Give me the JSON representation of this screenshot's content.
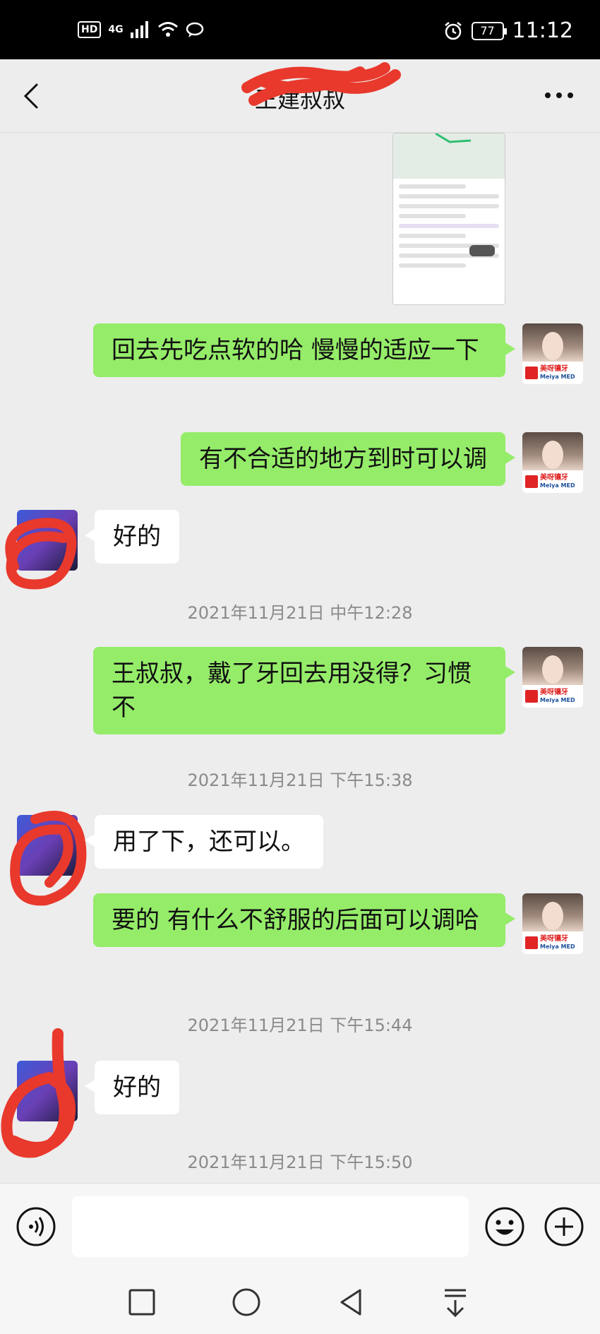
{
  "status_bar": {
    "hd": "HD",
    "network": "4G",
    "battery": "77",
    "time": "11:12"
  },
  "header": {
    "title": "王建叔叔"
  },
  "messages": [
    {
      "text": "回去先吃点软的哈 慢慢的适应一下"
    },
    {
      "text": "有不合适的地方到时可以调"
    },
    {
      "text": "好的"
    },
    {
      "text": "王叔叔，戴了牙回去用没得？习惯不"
    },
    {
      "text": "用了下，还可以。"
    },
    {
      "text": "要的 有什么不舒服的后面可以调哈"
    },
    {
      "text": "好的"
    }
  ],
  "timestamps": [
    "2021年11月21日 中午12:28",
    "2021年11月21日 下午15:38",
    "2021年11月21日 下午15:44",
    "2021年11月21日 下午15:50"
  ],
  "my_avatar": {
    "brand_cn": "美呀镶牙",
    "brand_en": "Meiya MED"
  },
  "colors": {
    "my_bubble": "#95ec69",
    "their_bubble": "#ffffff",
    "background": "#ededed",
    "redaction": "#e8392c"
  },
  "icons": [
    "back-arrow-icon",
    "more-icon",
    "voice-icon",
    "emoji-icon",
    "plus-icon",
    "nav-square-icon",
    "nav-circle-icon",
    "nav-back-icon",
    "nav-down-icon"
  ]
}
